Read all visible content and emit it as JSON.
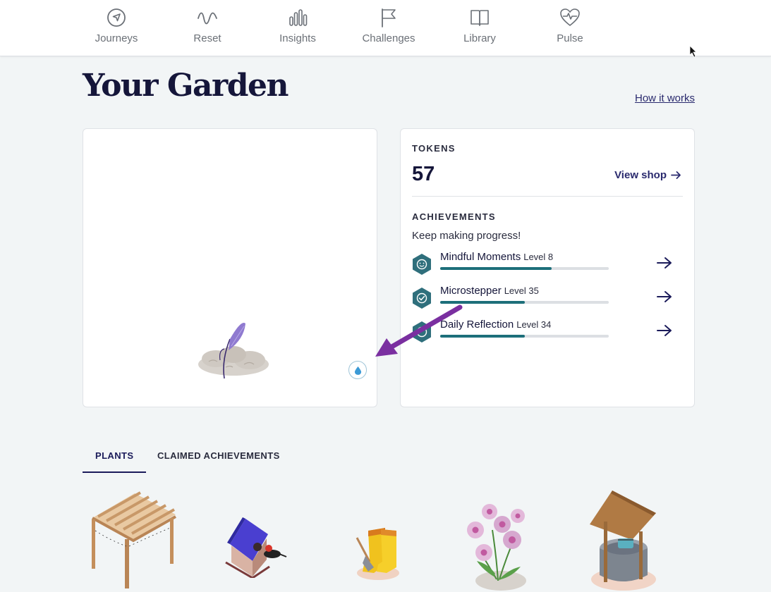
{
  "nav": {
    "items": [
      {
        "label": "Journeys",
        "icon": "compass-icon"
      },
      {
        "label": "Reset",
        "icon": "wave-icon"
      },
      {
        "label": "Insights",
        "icon": "bar-chart-icon"
      },
      {
        "label": "Challenges",
        "icon": "flag-icon"
      },
      {
        "label": "Library",
        "icon": "book-icon"
      },
      {
        "label": "Pulse",
        "icon": "heart-pulse-icon"
      }
    ]
  },
  "header": {
    "title": "Your Garden",
    "how_link": "How it works"
  },
  "tokens": {
    "label": "TOKENS",
    "count": "57",
    "view_shop": "View shop"
  },
  "achievements": {
    "label": "ACHIEVEMENTS",
    "subtitle": "Keep making progress!",
    "items": [
      {
        "name": "Mindful Moments",
        "level": "Level 8",
        "progress": 0.66,
        "icon": "smile-badge-icon"
      },
      {
        "name": "Microstepper",
        "level": "Level 35",
        "progress": 0.5,
        "icon": "check-badge-icon"
      },
      {
        "name": "Daily Reflection",
        "level": "Level 34",
        "progress": 0.5,
        "icon": "reflection-badge-icon"
      }
    ]
  },
  "tabs": {
    "plants": "PLANTS",
    "claimed": "CLAIMED ACHIEVEMENTS"
  },
  "colors": {
    "accent": "#1b1b5a",
    "progress": "#1d6f7a",
    "badge": "#2f6f7c",
    "annotation": "#7a2fa0"
  }
}
